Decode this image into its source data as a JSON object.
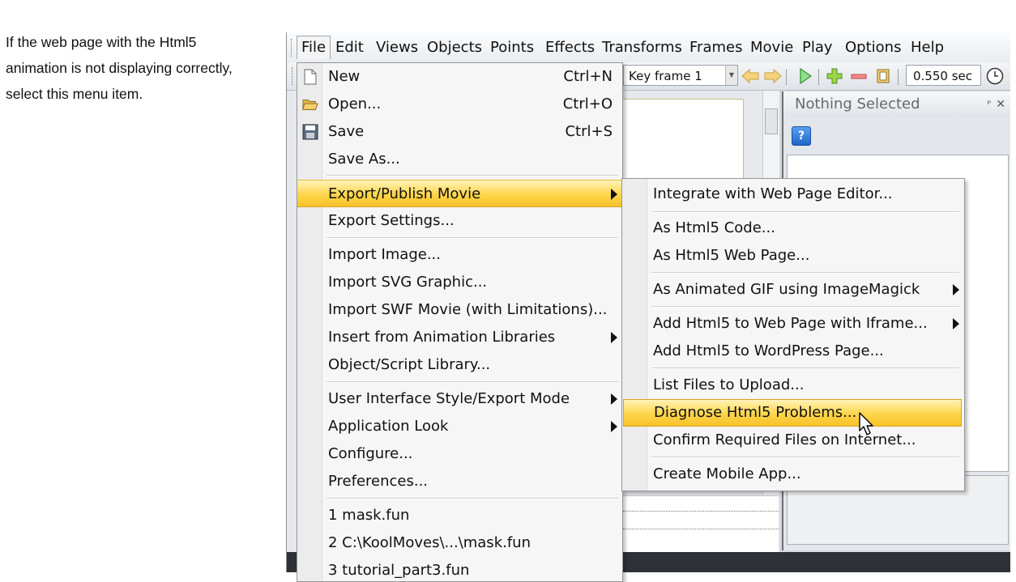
{
  "caption": {
    "lines": [
      "If the web page with the Html5",
      "animation is not displaying correctly,",
      "select this menu item."
    ]
  },
  "menubar": {
    "items": [
      "File",
      "Edit",
      "Views",
      "Objects",
      "Points",
      "Effects",
      "Transforms",
      "Frames",
      "Movie",
      "Play",
      "Options",
      "Help"
    ],
    "active": "File"
  },
  "toolbar": {
    "keyframe_value": "Key frame 1",
    "time_value": "0.550 sec",
    "icons": [
      "arrow-left-icon",
      "arrow-right-icon",
      "play-icon",
      "add-frame-icon",
      "remove-frame-icon",
      "frame-properties-icon",
      "clock-icon"
    ]
  },
  "panel": {
    "title": "Nothing Selected",
    "help_label": "?"
  },
  "file_menu": {
    "items": [
      {
        "label": "New",
        "shortcut": "Ctrl+N",
        "icon": "new-document-icon"
      },
      {
        "label": "Open...",
        "shortcut": "Ctrl+O",
        "icon": "open-folder-icon"
      },
      {
        "label": "Save",
        "shortcut": "Ctrl+S",
        "icon": "save-disk-icon"
      },
      {
        "label": "Save As..."
      },
      {
        "label": "Export/Publish Movie",
        "submenu": true,
        "highlighted": true
      },
      {
        "label": "Export Settings..."
      },
      {
        "label": "Import Image..."
      },
      {
        "label": "Import SVG Graphic..."
      },
      {
        "label": "Import SWF Movie (with Limitations)..."
      },
      {
        "label": "Insert from Animation Libraries",
        "submenu": true
      },
      {
        "label": "Object/Script Library..."
      },
      {
        "label": "User Interface Style/Export Mode",
        "submenu": true
      },
      {
        "label": "Application Look",
        "submenu": true
      },
      {
        "label": "Configure..."
      },
      {
        "label": "Preferences..."
      },
      {
        "label": "1 mask.fun"
      },
      {
        "label": "2 C:\\KoolMoves\\...\\mask.fun"
      },
      {
        "label": "3 tutorial_part3.fun"
      }
    ]
  },
  "export_submenu": {
    "items": [
      {
        "label": "Integrate with Web Page Editor..."
      },
      {
        "label": "As Html5 Code..."
      },
      {
        "label": "As Html5 Web Page..."
      },
      {
        "label": "As Animated GIF using ImageMagick",
        "submenu": true
      },
      {
        "label": "Add Html5 to Web Page with Iframe...",
        "submenu": true
      },
      {
        "label": "Add Html5 to WordPress Page..."
      },
      {
        "label": "List Files to Upload..."
      },
      {
        "label": "Diagnose Html5 Problems...",
        "highlighted": true
      },
      {
        "label": "Confirm Required Files on Internet..."
      },
      {
        "label": "Create Mobile App..."
      }
    ]
  },
  "colors": {
    "highlight": "#ffd54a",
    "menu_bg": "#f6f6f6",
    "statusbar": "#2e3136"
  }
}
